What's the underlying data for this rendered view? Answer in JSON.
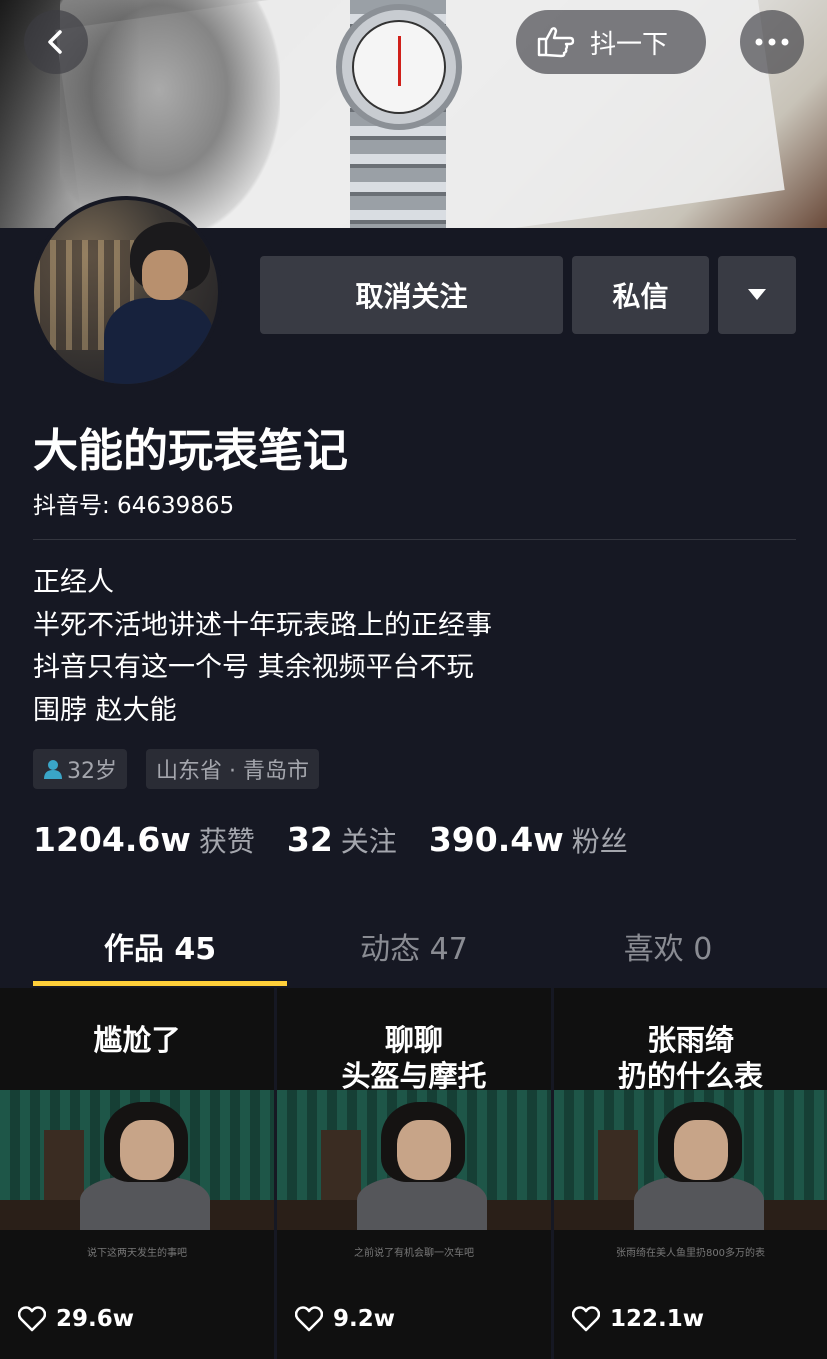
{
  "header": {
    "shake_label": "抖一下"
  },
  "profile": {
    "nickname": "大能的玩表笔记",
    "douyin_id": "抖音号: 64639865",
    "unfollow_label": "取消关注",
    "message_label": "私信",
    "bio_lines": [
      "正经人",
      "半死不活地讲述十年玩表路上的正经事",
      "抖音只有这一个号 其余视频平台不玩",
      "围脖 赵大能"
    ],
    "tags": {
      "age": "32岁",
      "location": "山东省 · 青岛市"
    },
    "stats": {
      "likes_value": "1204.6w",
      "likes_label": "获赞",
      "following_value": "32",
      "following_label": "关注",
      "followers_value": "390.4w",
      "followers_label": "粉丝"
    }
  },
  "tabs": [
    {
      "label": "作品 45",
      "active": true
    },
    {
      "label": "动态 47",
      "active": false
    },
    {
      "label": "喜欢 0",
      "active": false
    }
  ],
  "videos": [
    {
      "title_lines": [
        "尴尬了"
      ],
      "caption": "说下这两天发生的事吧",
      "likes": "29.6w"
    },
    {
      "title_lines": [
        "聊聊",
        "头盔与摩托"
      ],
      "caption": "之前说了有机会聊一次车吧",
      "likes": "9.2w"
    },
    {
      "title_lines": [
        "张雨绮",
        "扔的什么表"
      ],
      "caption": "张雨绮在美人鱼里扔800多万的表",
      "likes": "122.1w"
    }
  ],
  "colors": {
    "background": "#161823",
    "button": "#393b44",
    "tab_indicator": "#fecf3a",
    "muted_text": "#a4a6ad"
  },
  "icons": [
    "back-icon",
    "shake-hand-icon",
    "more-icon",
    "triangle-down-icon",
    "user-icon",
    "heart-icon"
  ]
}
